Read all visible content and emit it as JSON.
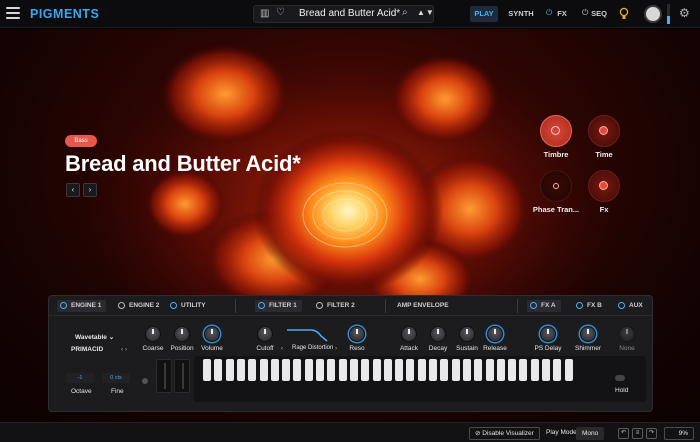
{
  "app": {
    "brand": "PIGMENTS"
  },
  "preset_bar": {
    "name": "Bread and Butter Acid*",
    "arrows": "▲▼"
  },
  "nav": {
    "play": "PLAY",
    "synth": "SYNTH",
    "fx": "FX",
    "seq": "SEQ"
  },
  "colors": {
    "accent": "#38a8ee",
    "tag": "#e8574a",
    "glow_core": "#fff3b0",
    "glow_mid": "#ff8a1a",
    "glow_outer": "#b81e0a"
  },
  "preset": {
    "tag": "Bass",
    "title": "Bread and Butter Acid*",
    "prev": "‹",
    "next": "›"
  },
  "macros": [
    {
      "label": "Timbre",
      "level": 0.5
    },
    {
      "label": "Time",
      "level": 0.3
    },
    {
      "label": "Phase Tran...",
      "level": 0.0
    },
    {
      "label": "Fx",
      "level": 0.3
    }
  ],
  "panel": {
    "tabs": {
      "engine1": "ENGINE 1",
      "engine2": "ENGINE 2",
      "utility": "UTILITY",
      "filter1": "FILTER 1",
      "filter2": "FILTER 2",
      "amp_envelope": "AMP ENVELOPE",
      "fx_a": "FX A",
      "fx_b": "FX B",
      "aux": "AUX"
    },
    "engine": {
      "type": "Wavetable",
      "wavetable": "PRIMACID",
      "coarse": "Coarse",
      "position": "Position",
      "volume": "Volume"
    },
    "filter": {
      "cutoff": "Cutoff",
      "type": "Rage Distortion",
      "reso": "Reso"
    },
    "env": {
      "attack": "Attack",
      "decay": "Decay",
      "sustain": "Sustain",
      "release": "Release"
    },
    "fx": {
      "ps_delay": "PS Delay",
      "shimmer": "Shimmer",
      "none": "None"
    },
    "octave": {
      "label": "Octave",
      "value": "-1"
    },
    "fine": {
      "label": "Fine",
      "value": "0 cts"
    },
    "hold": "Hold"
  },
  "status": {
    "disable_visualizer": "Disable Visualizer",
    "play_mode_label": "Play Mode",
    "play_mode_value": "Mono",
    "cpu": "9%"
  }
}
